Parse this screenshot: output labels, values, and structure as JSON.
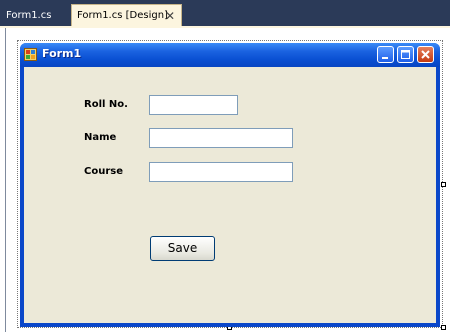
{
  "tabs": [
    {
      "label": "Form1.cs",
      "active": false
    },
    {
      "label": "Form1.cs [Design]",
      "active": true
    }
  ],
  "tab_close_icon": "close-icon",
  "form": {
    "title": "Form1",
    "icon": "form-icon",
    "caption_buttons": [
      "minimize-icon",
      "maximize-icon",
      "close-icon"
    ]
  },
  "fields": [
    {
      "label": "Roll No.",
      "value": ""
    },
    {
      "label": "Name",
      "value": ""
    },
    {
      "label": "Course",
      "value": ""
    }
  ],
  "save_label": "Save",
  "colors": {
    "tabstrip": "#2b3a58",
    "active_tab": "#fcf5df",
    "titlebar": "#0a4fd2",
    "client": "#ece9d8"
  }
}
